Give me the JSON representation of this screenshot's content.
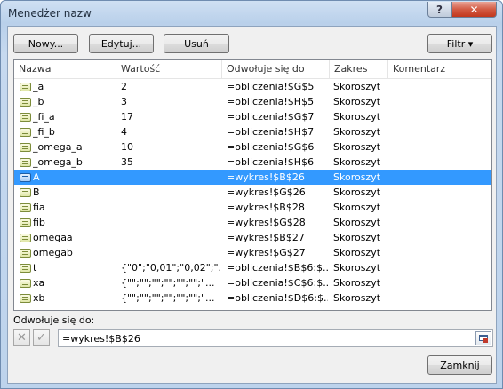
{
  "window": {
    "title": "Menedżer nazw"
  },
  "titlebar": {
    "help_label": "?",
    "close_label": "✕"
  },
  "toolbar": {
    "new_label": "Nowy...",
    "edit_label": "Edytuj...",
    "delete_label": "Usuń",
    "filter_label": "Filtr ▾"
  },
  "columns": [
    "Nazwa",
    "Wartość",
    "Odwołuje się do",
    "Zakres",
    "Komentarz"
  ],
  "rows": [
    {
      "name": "_a",
      "value": "2",
      "ref": "=obliczenia!$G$5",
      "scope": "Skoroszyt",
      "comment": ""
    },
    {
      "name": "_b",
      "value": "3",
      "ref": "=obliczenia!$H$5",
      "scope": "Skoroszyt",
      "comment": ""
    },
    {
      "name": "_fi_a",
      "value": "17",
      "ref": "=obliczenia!$G$7",
      "scope": "Skoroszyt",
      "comment": ""
    },
    {
      "name": "_fi_b",
      "value": "4",
      "ref": "=obliczenia!$H$7",
      "scope": "Skoroszyt",
      "comment": ""
    },
    {
      "name": "_omega_a",
      "value": "10",
      "ref": "=obliczenia!$G$6",
      "scope": "Skoroszyt",
      "comment": ""
    },
    {
      "name": "_omega_b",
      "value": "35",
      "ref": "=obliczenia!$H$6",
      "scope": "Skoroszyt",
      "comment": ""
    },
    {
      "name": "A",
      "value": "",
      "ref": "=wykres!$B$26",
      "scope": "Skoroszyt",
      "comment": "",
      "selected": true
    },
    {
      "name": "B",
      "value": "",
      "ref": "=wykres!$G$26",
      "scope": "Skoroszyt",
      "comment": ""
    },
    {
      "name": "fia",
      "value": "",
      "ref": "=wykres!$B$28",
      "scope": "Skoroszyt",
      "comment": ""
    },
    {
      "name": "fib",
      "value": "",
      "ref": "=wykres!$G$28",
      "scope": "Skoroszyt",
      "comment": ""
    },
    {
      "name": "omegaa",
      "value": "",
      "ref": "=wykres!$B$27",
      "scope": "Skoroszyt",
      "comment": ""
    },
    {
      "name": "omegab",
      "value": "",
      "ref": "=wykres!$G$27",
      "scope": "Skoroszyt",
      "comment": ""
    },
    {
      "name": "t",
      "value": "{\"0\";\"0,01\";\"0,02\";\"...",
      "ref": "=obliczenia!$B$6:$...",
      "scope": "Skoroszyt",
      "comment": ""
    },
    {
      "name": "xa",
      "value": "{\"\";\"\";\"\";\"\";\"\";\"\";\"...",
      "ref": "=obliczenia!$C$6:$...",
      "scope": "Skoroszyt",
      "comment": ""
    },
    {
      "name": "xb",
      "value": "{\"\";\"\";\"\";\"\";\"\";\"\";\"...",
      "ref": "=obliczenia!$D$6:$...",
      "scope": "Skoroszyt",
      "comment": ""
    }
  ],
  "refers_to": {
    "label": "Odwołuje się do:",
    "value": "=wykres!$B$26",
    "cancel_icon": "✕",
    "confirm_icon": "✓"
  },
  "footer": {
    "close_label": "Zamknij"
  }
}
